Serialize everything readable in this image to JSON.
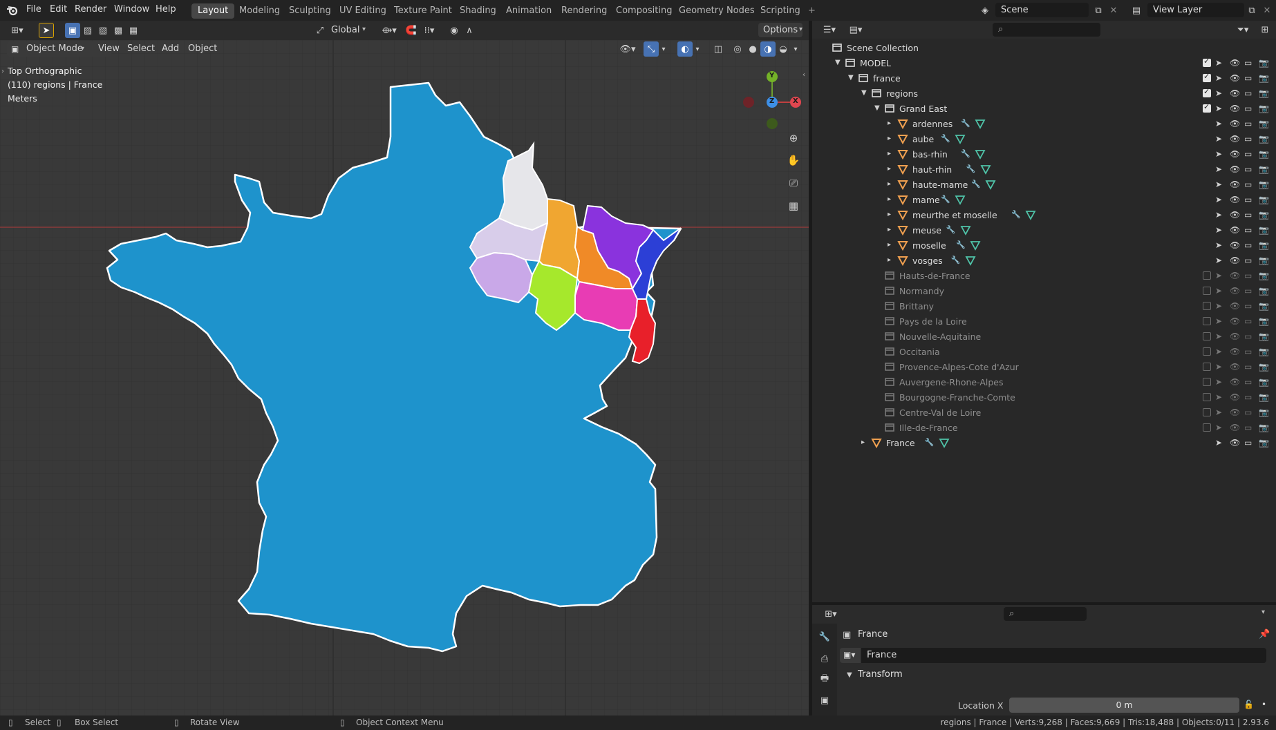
{
  "topbar": {
    "menus": [
      "File",
      "Edit",
      "Render",
      "Window",
      "Help"
    ],
    "workspace_tabs": [
      "Layout",
      "Modeling",
      "Sculpting",
      "UV Editing",
      "Texture Paint",
      "Shading",
      "Animation",
      "Rendering",
      "Compositing",
      "Geometry Nodes",
      "Scripting"
    ],
    "active_tab": "Layout",
    "add_tab": "+",
    "scene_name": "Scene",
    "view_layer_name": "View Layer"
  },
  "tool_header": {
    "transform_orientation": "Global",
    "options_label": "Options"
  },
  "viewport_header": {
    "mode": "Object Mode",
    "menus": [
      "View",
      "Select",
      "Add",
      "Object"
    ]
  },
  "viewport": {
    "view_name": "Top Orthographic",
    "context_info": "(110) regions | France",
    "units": "Meters",
    "gizmo_axes": {
      "y": "Y",
      "z": "Z",
      "x": "X"
    },
    "colors": {
      "background": "#393939",
      "france": "#1e93cc",
      "ardennes": "#e6e6ea",
      "marne": "#d8cdea",
      "aube": "#c9a8e8",
      "meuse": "#f0a631",
      "haute_marne": "#a6e82c",
      "meurthe_moselle": "#f08a27",
      "moselle": "#8a33dd",
      "vosges": "#e83cb4",
      "bas_rhin": "#2c3fd6",
      "haut_rhin": "#e8202a"
    }
  },
  "outliner": {
    "search_placeholder": "",
    "rows": [
      {
        "label": "Scene Collection",
        "type": "scene",
        "indent": 0,
        "tri": ""
      },
      {
        "label": "MODEL",
        "type": "collection",
        "indent": 1,
        "tri": "▼",
        "checked": true
      },
      {
        "label": "france",
        "type": "collection",
        "indent": 2,
        "tri": "▼",
        "checked": true
      },
      {
        "label": "regions",
        "type": "collection",
        "indent": 3,
        "tri": "▼",
        "checked": true
      },
      {
        "label": "Grand East",
        "type": "collection",
        "indent": 4,
        "tri": "▼",
        "checked": true
      },
      {
        "label": "ardennes",
        "type": "mesh",
        "indent": 5,
        "tri": "▸"
      },
      {
        "label": "aube",
        "type": "mesh",
        "indent": 5,
        "tri": "▸"
      },
      {
        "label": "bas-rhin",
        "type": "mesh",
        "indent": 5,
        "tri": "▸"
      },
      {
        "label": "haut-rhin",
        "type": "mesh",
        "indent": 5,
        "tri": "▸"
      },
      {
        "label": "haute-mame",
        "type": "mesh",
        "indent": 5,
        "tri": "▸"
      },
      {
        "label": "mame",
        "type": "mesh",
        "indent": 5,
        "tri": "▸"
      },
      {
        "label": "meurthe et moselle",
        "type": "mesh",
        "indent": 5,
        "tri": "▸"
      },
      {
        "label": "meuse",
        "type": "mesh",
        "indent": 5,
        "tri": "▸"
      },
      {
        "label": "moselle",
        "type": "mesh",
        "indent": 5,
        "tri": "▸"
      },
      {
        "label": "vosges",
        "type": "mesh",
        "indent": 5,
        "tri": "▸"
      },
      {
        "label": "Hauts-de-France",
        "type": "collection-dim",
        "indent": 4,
        "tri": "",
        "checked": false
      },
      {
        "label": "Normandy",
        "type": "collection-dim",
        "indent": 4,
        "tri": "",
        "checked": false
      },
      {
        "label": "Brittany",
        "type": "collection-dim",
        "indent": 4,
        "tri": "",
        "checked": false
      },
      {
        "label": "Pays de la Loire",
        "type": "collection-dim",
        "indent": 4,
        "tri": "",
        "checked": false
      },
      {
        "label": "Nouvelle-Aquitaine",
        "type": "collection-dim",
        "indent": 4,
        "tri": "",
        "checked": false
      },
      {
        "label": "Occitania",
        "type": "collection-dim",
        "indent": 4,
        "tri": "",
        "checked": false
      },
      {
        "label": "Provence-Alpes-Cote d'Azur",
        "type": "collection-dim",
        "indent": 4,
        "tri": "",
        "checked": false
      },
      {
        "label": "Auvergene-Rhone-Alpes",
        "type": "collection-dim",
        "indent": 4,
        "tri": "",
        "checked": false
      },
      {
        "label": "Bourgogne-Franche-Comte",
        "type": "collection-dim",
        "indent": 4,
        "tri": "",
        "checked": false
      },
      {
        "label": "Centre-Val de Loire",
        "type": "collection-dim",
        "indent": 4,
        "tri": "",
        "checked": false
      },
      {
        "label": "Ille-de-France",
        "type": "collection-dim",
        "indent": 4,
        "tri": "",
        "checked": false
      },
      {
        "label": "France",
        "type": "mesh",
        "indent": 3,
        "tri": "▸"
      }
    ]
  },
  "properties": {
    "object_name": "France",
    "data_name": "France",
    "section": "Transform",
    "location_x_label": "Location X",
    "location_x_value": "0 m"
  },
  "statusbar": {
    "select": "Select",
    "box_select": "Box Select",
    "rotate_view": "Rotate View",
    "context_menu": "Object Context Menu",
    "stats": "regions | France | Verts:9,268 | Faces:9,669 | Tris:18,488 | Objects:0/11 | 2.93.6"
  }
}
